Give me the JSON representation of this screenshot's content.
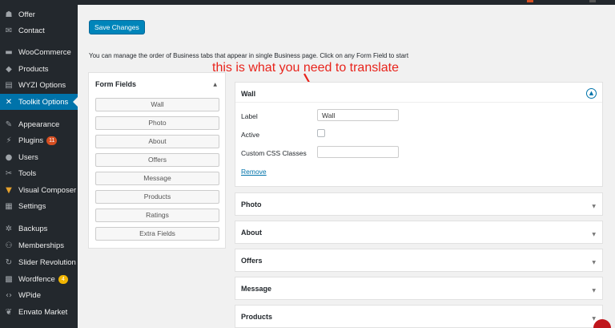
{
  "sidebar": {
    "items": [
      {
        "label": "Offer",
        "icon": "offer-icon",
        "glyph": "☗"
      },
      {
        "label": "Contact",
        "icon": "envelope-icon",
        "glyph": "✉"
      },
      {
        "label": "WooCommerce",
        "icon": "woocommerce-icon",
        "glyph": "▬"
      },
      {
        "label": "Products",
        "icon": "box-icon",
        "glyph": "◆"
      },
      {
        "label": "WYZI Options",
        "icon": "options-icon",
        "glyph": "▤"
      },
      {
        "label": "Toolkit Options",
        "icon": "toolkit-icon",
        "glyph": "✕"
      },
      {
        "label": "Appearance",
        "icon": "paintbrush-icon",
        "glyph": "✎"
      },
      {
        "label": "Plugins",
        "icon": "plugin-icon",
        "glyph": "⚡",
        "badge": "11"
      },
      {
        "label": "Users",
        "icon": "user-icon",
        "glyph": "●"
      },
      {
        "label": "Tools",
        "icon": "wrench-icon",
        "glyph": "✂"
      },
      {
        "label": "Visual Composer",
        "icon": "visual-composer-icon",
        "glyph": "▼"
      },
      {
        "label": "Settings",
        "icon": "settings-icon",
        "glyph": "▦"
      },
      {
        "label": "Backups",
        "icon": "backup-gear-icon",
        "glyph": "✲"
      },
      {
        "label": "Memberships",
        "icon": "memberships-icon",
        "glyph": "⚇"
      },
      {
        "label": "Slider Revolution",
        "icon": "refresh-icon",
        "glyph": "↻"
      },
      {
        "label": "Wordfence",
        "icon": "wordfence-icon",
        "glyph": "▩",
        "badge": "4"
      },
      {
        "label": "WPide",
        "icon": "code-icon",
        "glyph": "‹›"
      },
      {
        "label": "Envato Market",
        "icon": "leaf-icon",
        "glyph": "❦"
      }
    ]
  },
  "main": {
    "save_label": "Save Changes",
    "intro": "You can manage the order of Business tabs that appear in single Business page. Click on any Form Field to start",
    "annotation": "this is what you need to translate"
  },
  "form_fields": {
    "title": "Form Fields",
    "items": [
      "Wall",
      "Photo",
      "About",
      "Offers",
      "Message",
      "Products",
      "Ratings",
      "Extra Fields"
    ]
  },
  "wall_panel": {
    "title": "Wall",
    "label_label": "Label",
    "label_value": "Wall",
    "active_label": "Active",
    "css_label": "Custom CSS Classes",
    "css_value": "",
    "remove_label": "Remove"
  },
  "accordions": [
    "Photo",
    "About",
    "Offers",
    "Message",
    "Products"
  ],
  "colors": {
    "sidebar_bg": "#23282d",
    "active": "#0073aa",
    "primary_button": "#0085ba",
    "annotation": "#e8241c",
    "plugin_badge": "#d54e21",
    "wordfence_badge": "#f0b400"
  }
}
